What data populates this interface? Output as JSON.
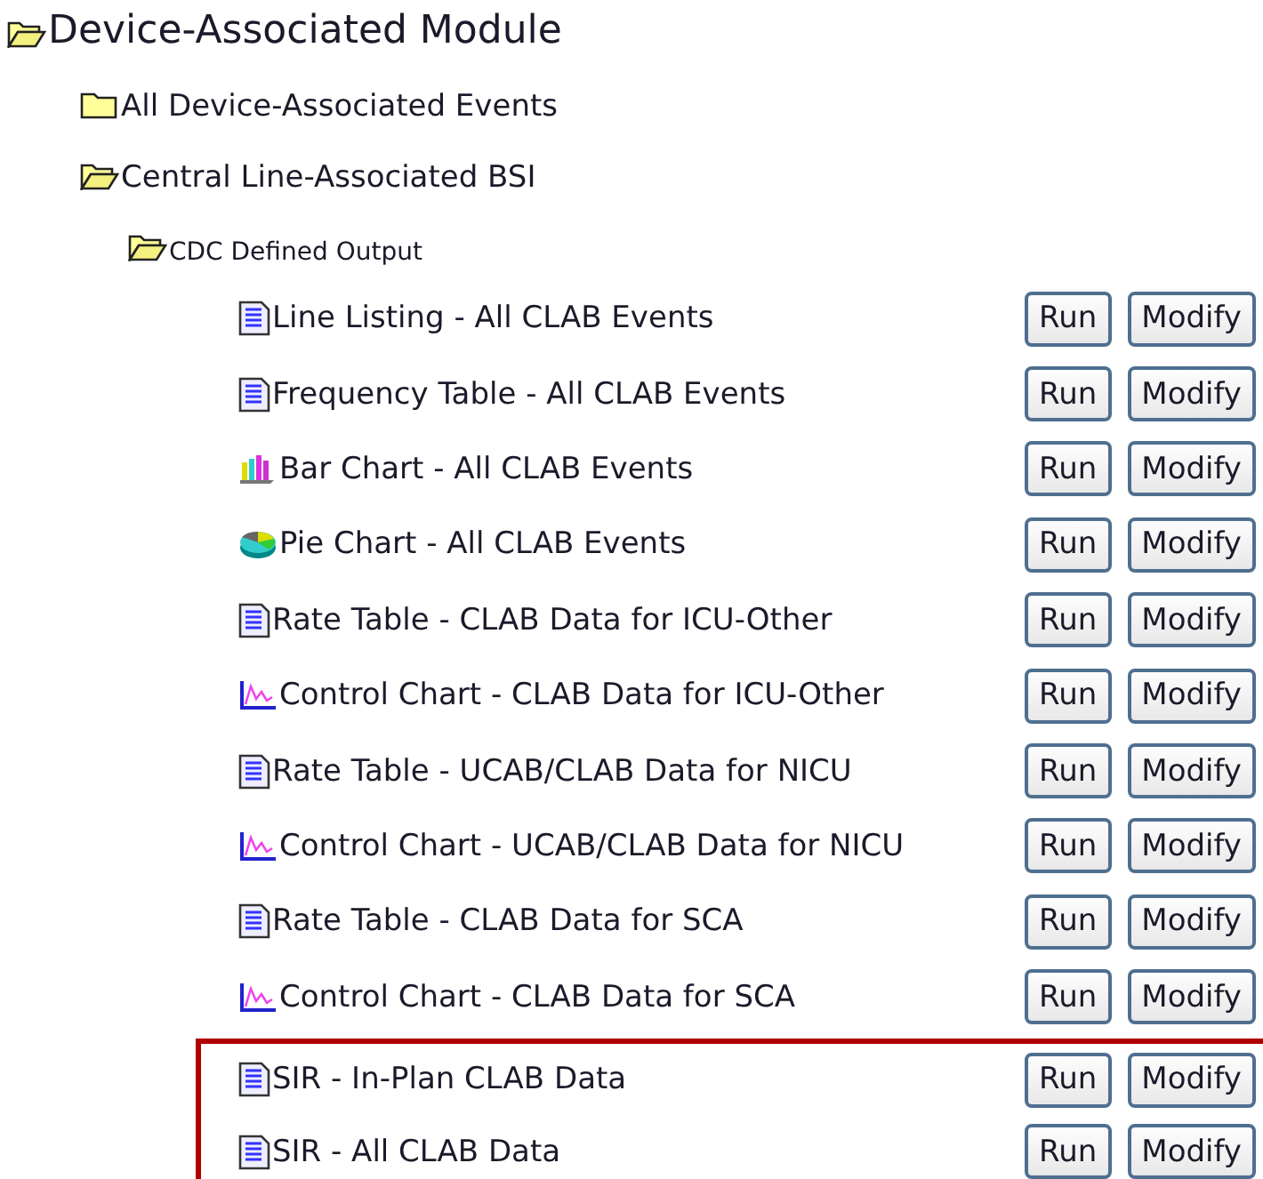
{
  "tree": {
    "label": "Device-Associated Module",
    "expanded": true,
    "children": [
      {
        "label": "All Device-Associated Events",
        "expanded": false
      },
      {
        "label": "Central Line-Associated BSI",
        "expanded": true,
        "children": [
          {
            "label": "CDC Defined Output",
            "expanded": true,
            "reports": [
              {
                "kind": "document",
                "label": "Line Listing - All CLAB Events",
                "highlighted": false,
                "buttons": [
                  "Run",
                  "Modify"
                ]
              },
              {
                "kind": "document",
                "label": "Frequency Table - All CLAB Events",
                "highlighted": false,
                "buttons": [
                  "Run",
                  "Modify"
                ]
              },
              {
                "kind": "bar",
                "label": "Bar Chart - All CLAB Events",
                "highlighted": false,
                "buttons": [
                  "Run",
                  "Modify"
                ]
              },
              {
                "kind": "pie",
                "label": "Pie Chart - All CLAB Events",
                "highlighted": false,
                "buttons": [
                  "Run",
                  "Modify"
                ]
              },
              {
                "kind": "document",
                "label": "Rate Table - CLAB Data for ICU-Other",
                "highlighted": false,
                "buttons": [
                  "Run",
                  "Modify"
                ]
              },
              {
                "kind": "control",
                "label": "Control Chart - CLAB Data for ICU-Other",
                "highlighted": false,
                "buttons": [
                  "Run",
                  "Modify"
                ]
              },
              {
                "kind": "document",
                "label": "Rate Table - UCAB/CLAB Data for NICU",
                "highlighted": false,
                "buttons": [
                  "Run",
                  "Modify"
                ]
              },
              {
                "kind": "control",
                "label": "Control Chart - UCAB/CLAB Data for NICU",
                "highlighted": false,
                "buttons": [
                  "Run",
                  "Modify"
                ]
              },
              {
                "kind": "document",
                "label": "Rate Table - CLAB Data for SCA",
                "highlighted": false,
                "buttons": [
                  "Run",
                  "Modify"
                ]
              },
              {
                "kind": "control",
                "label": "Control Chart - CLAB Data for SCA",
                "highlighted": false,
                "buttons": [
                  "Run",
                  "Modify"
                ]
              },
              {
                "kind": "document",
                "label": "SIR - In-Plan CLAB Data",
                "highlighted": true,
                "buttons": [
                  "Run",
                  "Modify"
                ]
              },
              {
                "kind": "document",
                "label": "SIR - All CLAB Data",
                "highlighted": true,
                "buttons": [
                  "Run",
                  "Modify"
                ]
              }
            ]
          }
        ]
      }
    ]
  }
}
